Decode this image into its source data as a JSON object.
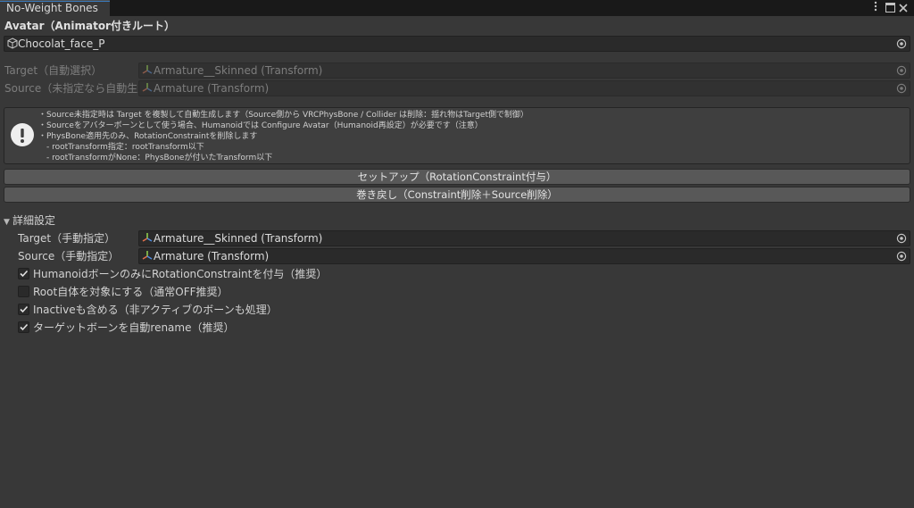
{
  "window": {
    "tab_title": "No-Weight Bones",
    "menu_icon": "kebab-menu-icon",
    "maximize_icon": "maximize-icon",
    "close_icon": "close-icon"
  },
  "avatar": {
    "label": "Avatar（Animator付きルート）",
    "value": "Chocolat_face_P",
    "icon": "gameobject-cube-icon"
  },
  "target_auto": {
    "label": "Target（自動選択）",
    "value": "Armature__Skinned (Transform)",
    "icon": "transform-icon"
  },
  "source_auto": {
    "label": "Source（未指定なら自動生成）",
    "value": "Armature (Transform)",
    "icon": "transform-icon"
  },
  "help": {
    "icon": "warning-icon",
    "lines": [
      "・Source未指定時は Target を複製して自動生成します（Source側から VRCPhysBone / Collider は削除：揺れ物はTarget側で制御）",
      "・Sourceをアバターボーンとして使う場合、Humanoidでは Configure Avatar（Humanoid再設定）が必要です（注意）",
      "・PhysBone適用先のみ、RotationConstraintを削除します",
      "　- rootTransform指定：rootTransform以下",
      "　- rootTransformがNone：PhysBoneが付いたTransform以下"
    ]
  },
  "buttons": {
    "setup": "セットアップ（RotationConstraint付与）",
    "revert": "巻き戻し（Constraint削除＋Source削除）"
  },
  "advanced": {
    "foldout_label": "詳細設定",
    "target_label": "Target（手動指定）",
    "target_value": "Armature__Skinned (Transform)",
    "source_label": "Source（手動指定）",
    "source_value": "Armature (Transform)",
    "options": [
      {
        "label": "HumanoidボーンのみにRotationConstraintを付与（推奨）",
        "checked": true
      },
      {
        "label": "Root自体を対象にする（通常OFF推奨）",
        "checked": false
      },
      {
        "label": "Inactiveも含める（非アクティブのボーンも処理）",
        "checked": true
      },
      {
        "label": "ターゲットボーンを自動rename（推奨）",
        "checked": true
      }
    ]
  },
  "colors": {
    "background": "#383838",
    "field": "#2a2a2a",
    "button": "#585858",
    "tab_accent": "#3a79bb"
  }
}
